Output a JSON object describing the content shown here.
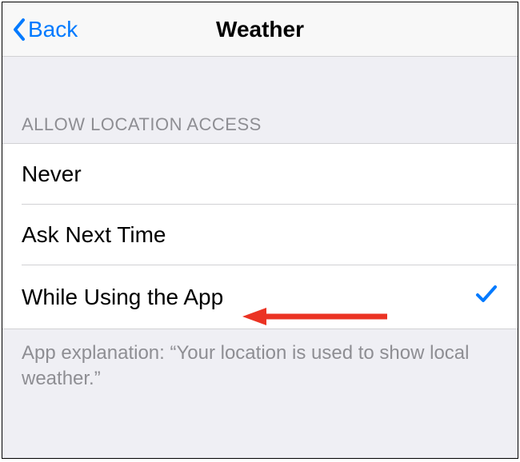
{
  "nav": {
    "back_label": "Back",
    "title": "Weather"
  },
  "section": {
    "header": "ALLOW LOCATION ACCESS",
    "options": [
      {
        "label": "Never",
        "selected": false
      },
      {
        "label": "Ask Next Time",
        "selected": false
      },
      {
        "label": "While Using the App",
        "selected": true
      }
    ],
    "footer": "App explanation: “Your location is used to show local weather.”"
  },
  "colors": {
    "accent": "#007aff",
    "annotation": "#e74c3c"
  }
}
